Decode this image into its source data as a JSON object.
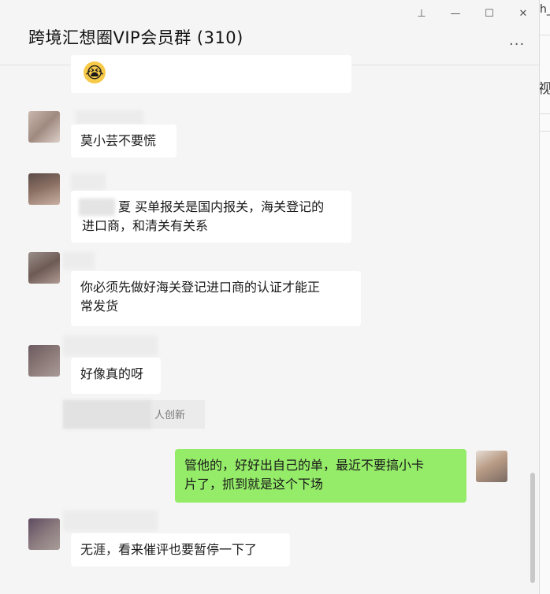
{
  "window": {
    "title": "跨境汇想圈VIP会员群 (310)",
    "pin_glyph": "⊥",
    "minimize_glyph": "—",
    "maximize_glyph": "☐",
    "close_glyph": "✕",
    "more_glyph": "···"
  },
  "right_panel": {
    "top_text": "h_",
    "mid_text": "视"
  },
  "messages": [
    {
      "side": "left",
      "text": "😭"
    },
    {
      "side": "left",
      "text": "莫小芸不要慌"
    },
    {
      "side": "left",
      "text_line1": "夏 买单报关是国内报关，海关登记的",
      "text_line2": "进口商，和清关有关系"
    },
    {
      "side": "left",
      "text_line1": "你必须先做好海关登记进口商的认证才能正",
      "text_line2": "常发货"
    },
    {
      "side": "left",
      "text": "好像真的呀"
    },
    {
      "side": "system",
      "text": "人创新"
    },
    {
      "side": "right",
      "text_line1": "管他的，好好出自己的单，最近不要搞小卡",
      "text_line2": "片了，抓到就是这个下场"
    },
    {
      "side": "left",
      "text": "无涯，看来催评也要暂停一下了"
    }
  ]
}
